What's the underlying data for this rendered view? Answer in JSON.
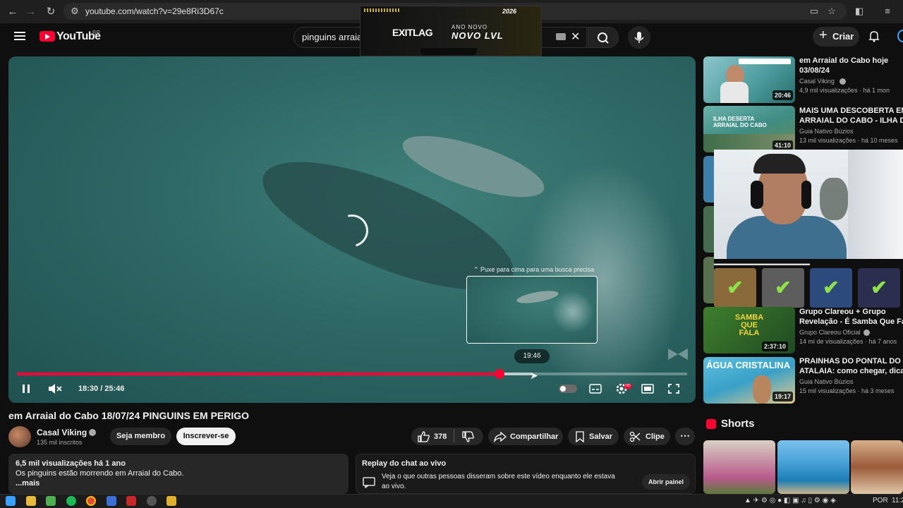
{
  "browser": {
    "url": "youtube.com/watch?v=29e8Ri3D67c"
  },
  "youtube": {
    "logo_text": "YouTube",
    "country_code": "BR",
    "search_query": "pinguins arraial",
    "create_label": "Criar"
  },
  "ad": {
    "brand": "EXITLAG",
    "tagline_small": "ANO NOVO",
    "tagline_big": "NOVO LVL",
    "year_badge": "2026"
  },
  "player": {
    "pull_hint": "⌃ Puxe para cima para uma busca precisa",
    "preview_time": "19:46",
    "time_display": "18:30 / 25:46",
    "progress": 0.72
  },
  "video": {
    "title": "em Arraial do Cabo 18/07/24 PINGUINS EM PERIGO",
    "channel": "Casal Viking",
    "subscribers": "135 mil inscritos",
    "member_label": "Seja membro",
    "subscribe_label": "Inscrever-se",
    "likes": "378",
    "share_label": "Compartilhar",
    "save_label": "Salvar",
    "clip_label": "Clipe"
  },
  "description": {
    "stats": "6,5 mil visualizações  há 1 ano",
    "text": "Os pinguins estão morrendo em Arraial do Cabo.",
    "more": "...mais"
  },
  "chat": {
    "title": "Replay do chat ao vivo",
    "text_line1": "Veja o que outras pessoas disseram sobre este vídeo enquanto ele estava",
    "text_line2": "ao vivo.",
    "button": "Abrir painel"
  },
  "related": [
    {
      "title_line1": "em Arraial do Cabo hoje",
      "title_line2": "03/08/24",
      "channel": "Casal Viking",
      "meta": "4,9 mil visualizações · há 1 mon",
      "duration": "20:46",
      "color": "#5aa7a8"
    },
    {
      "title_line1": "MAIS UMA DESCOBERTA EM",
      "title_line2": "ARRAIAL DO CABO - ILHA DO ...",
      "channel": "Guia Nativo Búzios",
      "meta": "13 mil visualizações · há 10 meses",
      "duration": "41:10",
      "color": "#3d8a83"
    },
    {
      "title_line1": "Grupo Clareou + Grupo",
      "title_line2": "Revelação - É Samba Que Fala",
      "channel": "Grupo Clareou Oficial",
      "meta": "14 mi de visualizações · há 7 anos",
      "duration": "2:37:10",
      "color": "#2f6d2c"
    },
    {
      "title_line1": "PRAINHAS DO PONTAL DO",
      "title_line2": "ATALAIA: como chegar, dicas ...",
      "channel": "Guia Nativo Búzios",
      "meta": "15 mil visualizações · há 3 meses",
      "duration": "19:17",
      "color": "#3aa0c7"
    }
  ],
  "thumb_texts": {
    "samba": "SAMBA QUE FALA",
    "agua": "ÁGUA CRISTALINA"
  },
  "shorts": {
    "title": "Shorts"
  },
  "taskbar": {
    "lang": "POR",
    "clock": "11:2"
  }
}
